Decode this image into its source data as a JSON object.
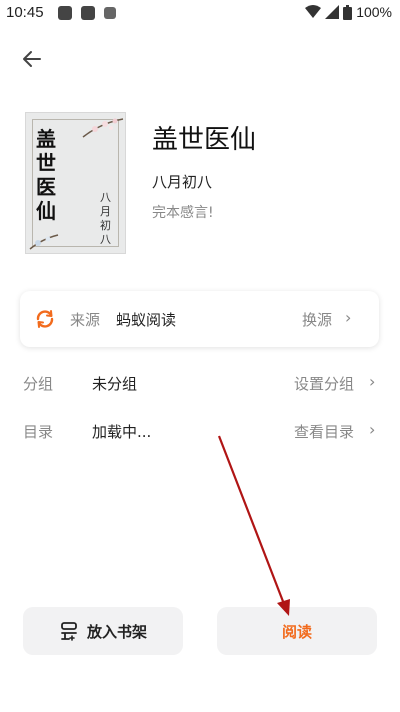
{
  "status_bar": {
    "time": "10:45",
    "battery": "100%"
  },
  "book": {
    "title": "盖世医仙",
    "author": "八月初八",
    "status": "完本感言!",
    "cover_title": "盖世医仙",
    "cover_author": "八月初八"
  },
  "source": {
    "label": "来源",
    "name": "蚂蚁阅读",
    "action": "换源"
  },
  "rows": [
    {
      "label": "分组",
      "value": "未分组",
      "action": "设置分组"
    },
    {
      "label": "目录",
      "value": "加载中...",
      "action": "查看目录"
    }
  ],
  "buttons": {
    "add_shelf": "放入书架",
    "read": "阅读"
  },
  "colors": {
    "accent": "#f26b1d",
    "annotation_arrow": "#b01515"
  },
  "icons": [
    "back-arrow-icon",
    "refresh-icon",
    "chevron-right-icon",
    "bookshelf-icon",
    "wifi-icon",
    "signal-icon",
    "battery-icon"
  ]
}
